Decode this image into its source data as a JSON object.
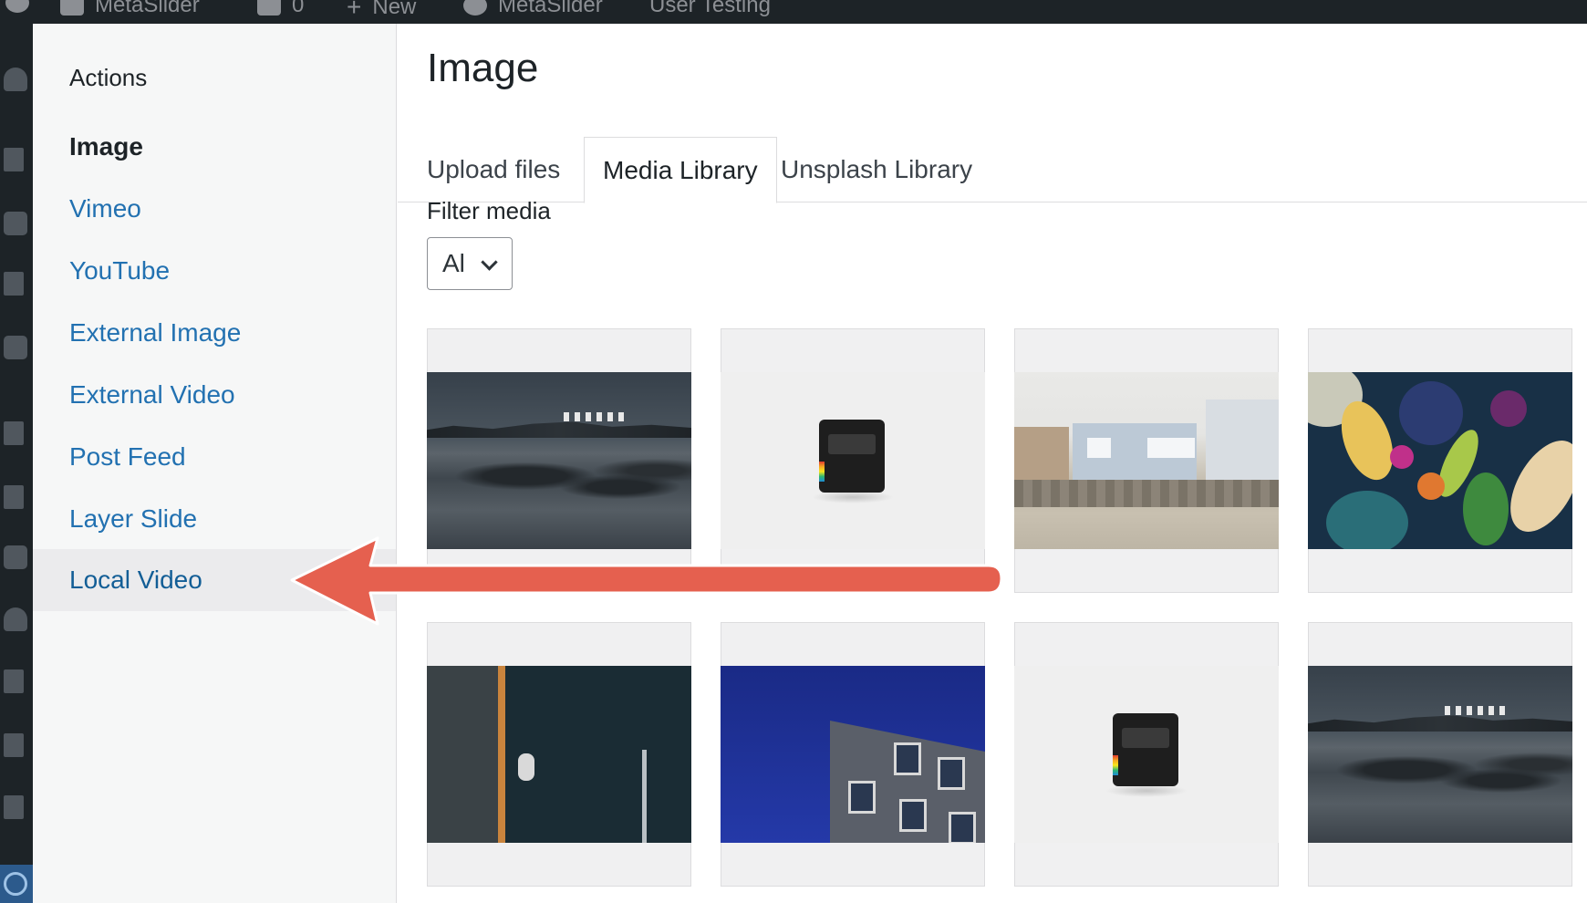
{
  "adminbar": {
    "items": [
      "MetaSlider",
      "0",
      "New",
      "MetaSlider",
      "User Testing"
    ]
  },
  "sidebar": {
    "heading": "Actions",
    "items": [
      {
        "label": "Image",
        "current": true
      },
      {
        "label": "Vimeo"
      },
      {
        "label": "YouTube"
      },
      {
        "label": "External Image"
      },
      {
        "label": "External Video"
      },
      {
        "label": "Post Feed"
      },
      {
        "label": "Layer Slide"
      },
      {
        "label": "Local Video",
        "highlighted": true
      }
    ]
  },
  "main": {
    "title": "Image",
    "tabs": [
      {
        "label": "Upload files"
      },
      {
        "label": "Media Library",
        "active": true
      },
      {
        "label": "Unsplash Library"
      }
    ],
    "filter": {
      "label": "Filter media",
      "selected": "Al"
    }
  },
  "colors": {
    "link": "#2271b1",
    "arrow": "#e5604f",
    "adminbar": "#1d2327"
  }
}
